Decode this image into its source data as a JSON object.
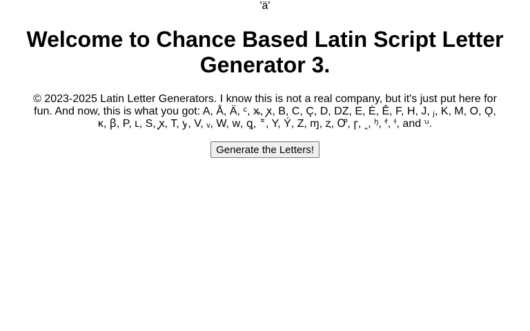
{
  "top_char": "'ä'",
  "heading": "Welcome to Chance Based Latin Script Letter Generator 3.",
  "paragraph": "© 2023-2025 Latin Letter Generators. I know this is not a real company, but it's just put here for fun. And now, this is what you got: A, Å, Ä, ᶜ, ꭖ, ꭗ, B, C, Ç, D, DZ, E, Ė, Ê, F, H, J, ⱼ, K, M, O, Ǫ, ĸ, ꞵ, P, ʟ, S, ꭙ, T, ꭚ, V, ᵥ, W, ᴡ, ꝗ, ꭛, Y, Ý, Z, ɱ, ȥ, Ꝍ, ꞅ, ꞈ, ꭜ, ꭝ, ꭞ, and ꭟ.",
  "button_label": "Generate the Letters!"
}
